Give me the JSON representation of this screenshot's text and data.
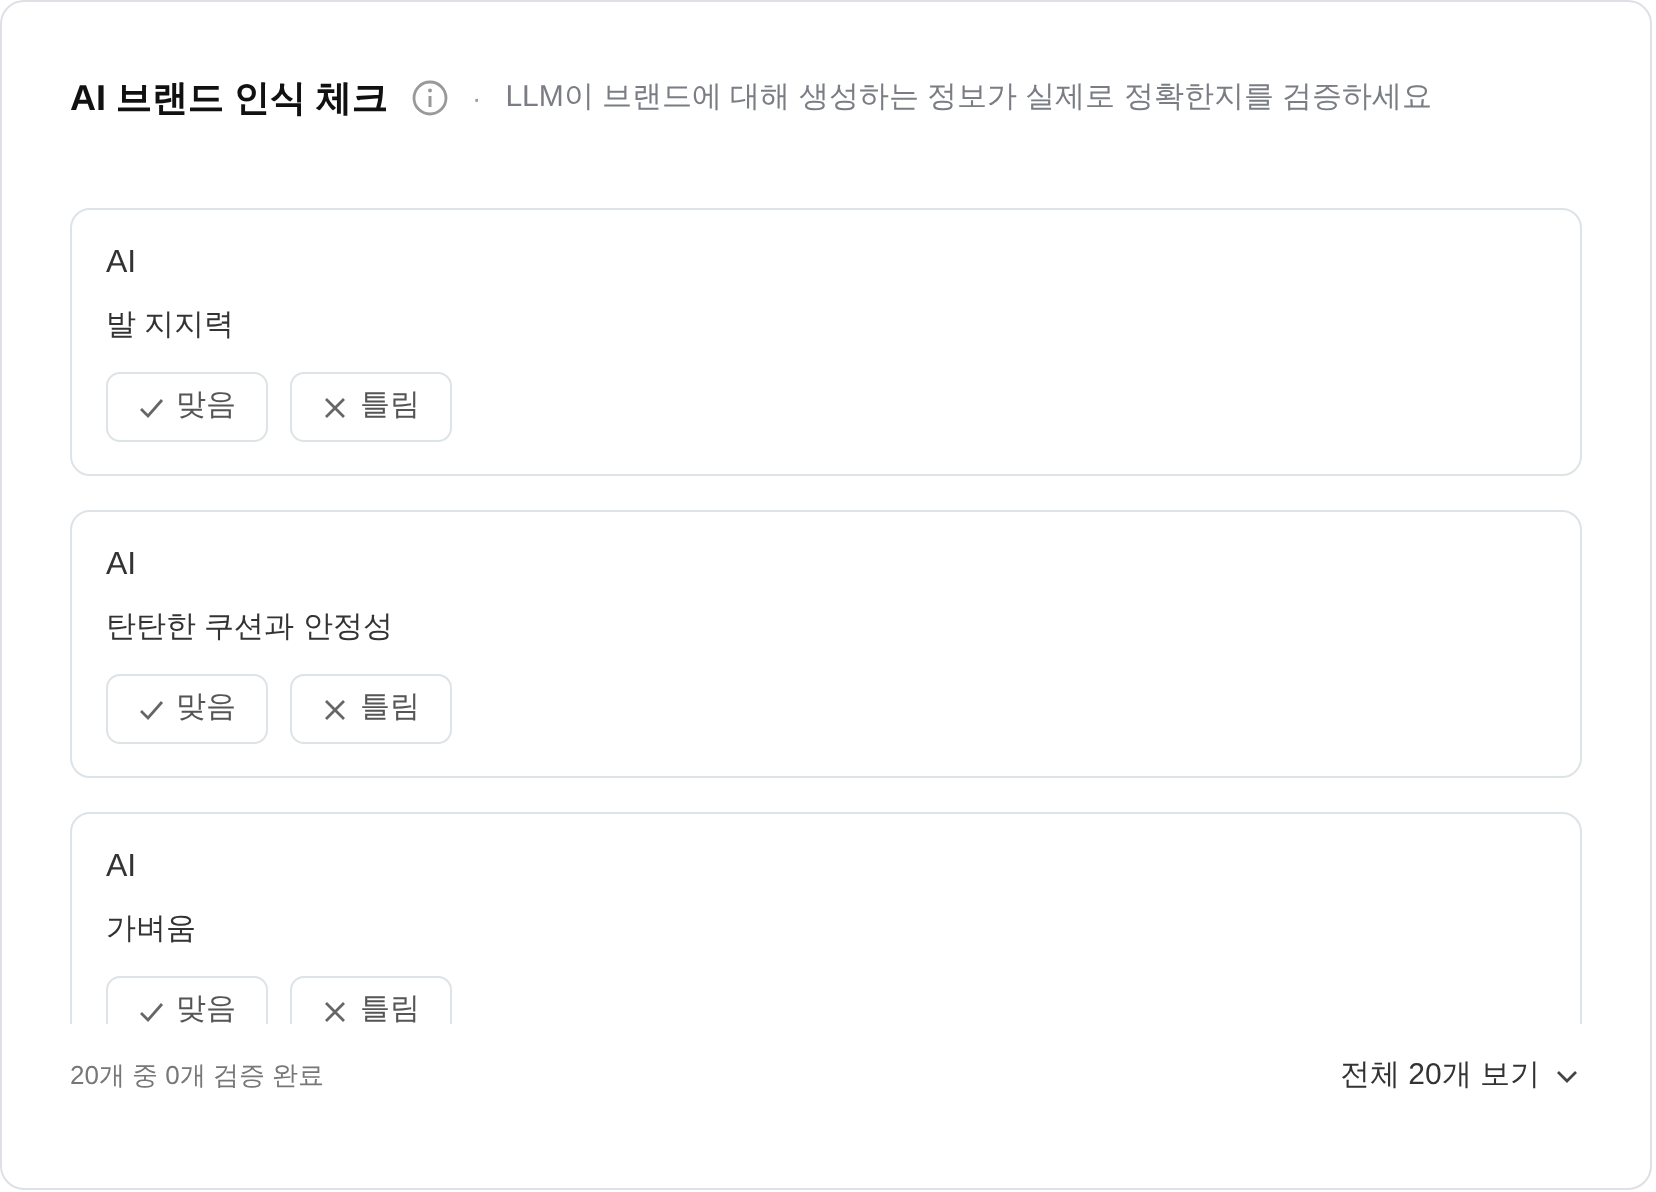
{
  "header": {
    "title": "AI 브랜드 인식 체크",
    "separator": "·",
    "subtitle": "LLM이 브랜드에 대해 생성하는 정보가 실제로 정확한지를 검증하세요"
  },
  "claims": [
    {
      "source": "AI",
      "text": "발 지지력",
      "buttons": [
        {
          "kind": "correct",
          "label": "맞음"
        },
        {
          "kind": "wrong",
          "label": "틀림"
        }
      ]
    },
    {
      "source": "AI",
      "text": "탄탄한 쿠션과 안정성",
      "buttons": [
        {
          "kind": "correct",
          "label": "맞음"
        },
        {
          "kind": "wrong",
          "label": "틀림"
        }
      ]
    },
    {
      "source": "AI",
      "text": "가벼움",
      "buttons": [
        {
          "kind": "correct",
          "label": "맞음"
        },
        {
          "kind": "wrong",
          "label": "틀림"
        }
      ]
    }
  ],
  "footer": {
    "progress": "20개 중 0개 검증 완료",
    "view_all": "전체 20개 보기"
  }
}
